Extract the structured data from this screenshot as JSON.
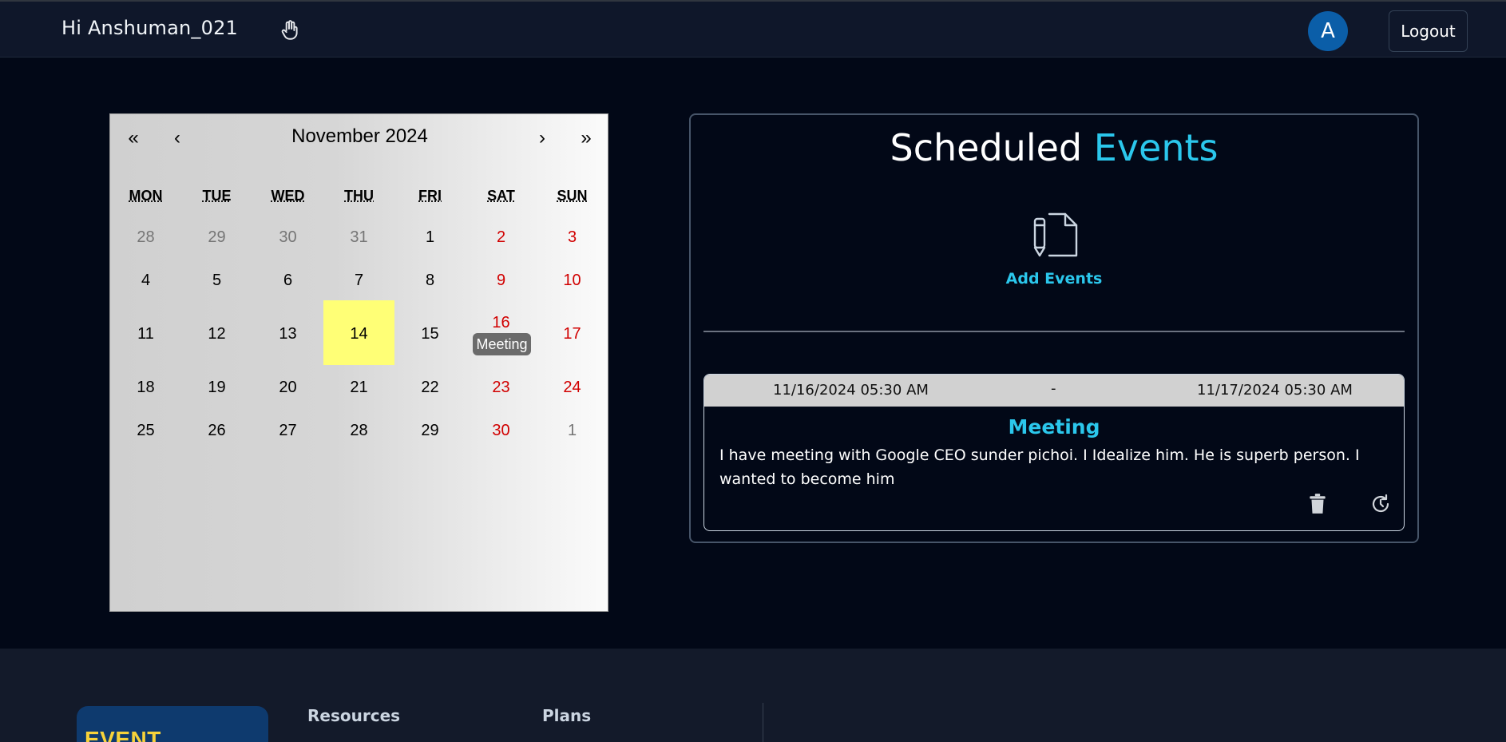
{
  "header": {
    "greeting": "Hi Anshuman_021",
    "wave_icon": "hand-wave-icon",
    "avatar_letter": "A",
    "logout_label": "Logout"
  },
  "calendar": {
    "month_label": "November 2024",
    "nav": {
      "prev_year": "«",
      "prev_month": "‹",
      "next_month": "›",
      "next_year": "»"
    },
    "weekdays": [
      "MON",
      "TUE",
      "WED",
      "THU",
      "FRI",
      "SAT",
      "SUN"
    ],
    "weeks": [
      [
        "28",
        "29",
        "30",
        "31",
        "1",
        "2",
        "3"
      ],
      [
        "4",
        "5",
        "6",
        "7",
        "8",
        "9",
        "10"
      ],
      [
        "11",
        "12",
        "13",
        "14",
        "15",
        "16",
        "17"
      ],
      [
        "18",
        "19",
        "20",
        "21",
        "22",
        "23",
        "24"
      ],
      [
        "25",
        "26",
        "27",
        "28",
        "29",
        "30",
        "1"
      ]
    ],
    "today": "14",
    "event_on_16": "Meeting"
  },
  "events_panel": {
    "title_main": "Scheduled",
    "title_accent": "Events",
    "add_label": "Add Events",
    "events": [
      {
        "start": "11/16/2024 05:30 AM",
        "separator": "-",
        "end": "11/17/2024 05:30 AM",
        "title": "Meeting",
        "description": "I have meeting with Google CEO sunder pichoi. I Idealize him. He is superb person. I wanted to become him"
      }
    ]
  },
  "footer": {
    "logo_text": "EVENT MANAGER",
    "resources_heading": "Resources",
    "plans_heading": "Plans"
  },
  "colors": {
    "background": "#020817",
    "header_bg": "#0f172a",
    "accent": "#2bc7ec",
    "avatar": "#0b5ea8",
    "today_highlight": "#ffff76",
    "weekend": "#d10000"
  }
}
